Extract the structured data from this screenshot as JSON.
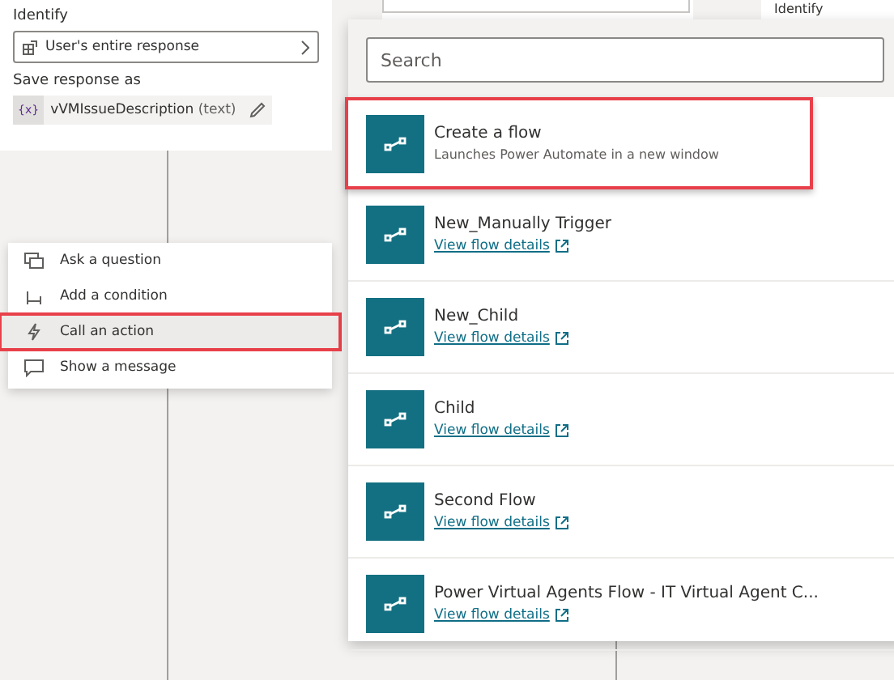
{
  "background_cards": [
    {
      "text": "Identify"
    }
  ],
  "question_node": {
    "identify_label": "Identify",
    "identify_value": "User's entire response",
    "save_label": "Save response as",
    "variable_badge": "{x}",
    "variable_name": "vVMIssueDescription",
    "variable_type": "(text)"
  },
  "add_menu": {
    "items": [
      {
        "kind": "question",
        "label": "Ask a question",
        "selected": false,
        "highlighted": false
      },
      {
        "kind": "condition",
        "label": "Add a condition",
        "selected": false,
        "highlighted": false
      },
      {
        "kind": "action",
        "label": "Call an action",
        "selected": true,
        "highlighted": true
      },
      {
        "kind": "message",
        "label": "Show a message",
        "selected": false,
        "highlighted": false
      }
    ]
  },
  "flow_picker": {
    "search": {
      "placeholder": "Search"
    },
    "flows": [
      {
        "name": "Create a flow",
        "description": "Launches Power Automate in a new window",
        "highlighted": true
      },
      {
        "name": "New_Manually Trigger",
        "link": "View flow details",
        "highlighted": false
      },
      {
        "name": "New_Child",
        "link": "View flow details",
        "highlighted": false
      },
      {
        "name": "Child",
        "link": "View flow details",
        "highlighted": false
      },
      {
        "name": "Second Flow",
        "link": "View flow details",
        "highlighted": false
      },
      {
        "name": "Power Virtual Agents Flow - IT Virtual Agent C...",
        "link": "View flow details",
        "highlighted": false
      }
    ]
  }
}
